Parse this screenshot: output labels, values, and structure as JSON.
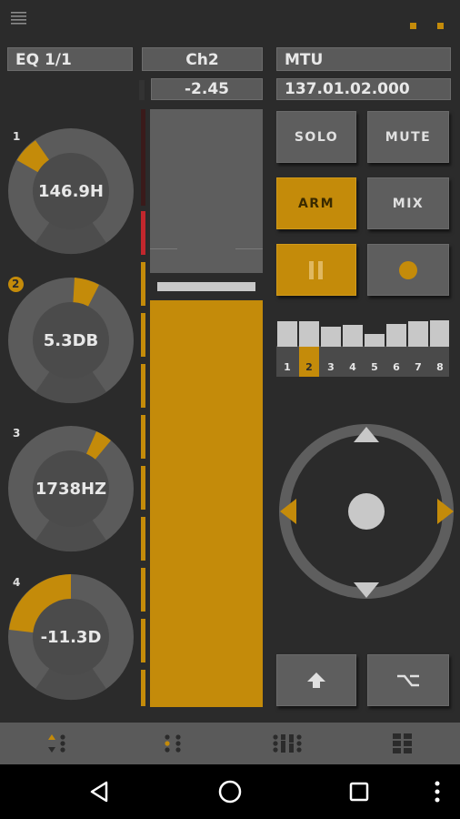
{
  "header": {
    "menu_icon": "hamburger-menu-icon"
  },
  "colors": {
    "accent": "#c48b0a",
    "panel": "#5e5e5e",
    "background": "#2b2b2b",
    "clip_red": "#c1272d"
  },
  "device": {
    "title": "EQ 1/1"
  },
  "channel": {
    "name": "Ch2",
    "volume": "-2.45",
    "fader_level": 0.71
  },
  "transport": {
    "mode": "MTU",
    "position": "137.01.02.000"
  },
  "knobs": [
    {
      "index": "1",
      "value": "146.9H",
      "highlighted": false
    },
    {
      "index": "2",
      "value": "5.3DB",
      "highlighted": true
    },
    {
      "index": "3",
      "value": "1738HZ",
      "highlighted": false
    },
    {
      "index": "4",
      "value": "-11.3D",
      "highlighted": false
    }
  ],
  "buttons": {
    "solo": "SOLO",
    "mute": "MUTE",
    "arm": "ARM",
    "mix": "MIX"
  },
  "mini_mixer": {
    "channels": [
      "1",
      "2",
      "3",
      "4",
      "5",
      "6",
      "7",
      "8"
    ],
    "selected": "2"
  },
  "bottom_tabs": [
    "dpad-tab-icon",
    "dots-tab-icon",
    "mixer-tab-icon",
    "grid-tab-icon"
  ],
  "system_nav": [
    "back-icon",
    "home-icon",
    "recents-icon",
    "more-icon"
  ]
}
